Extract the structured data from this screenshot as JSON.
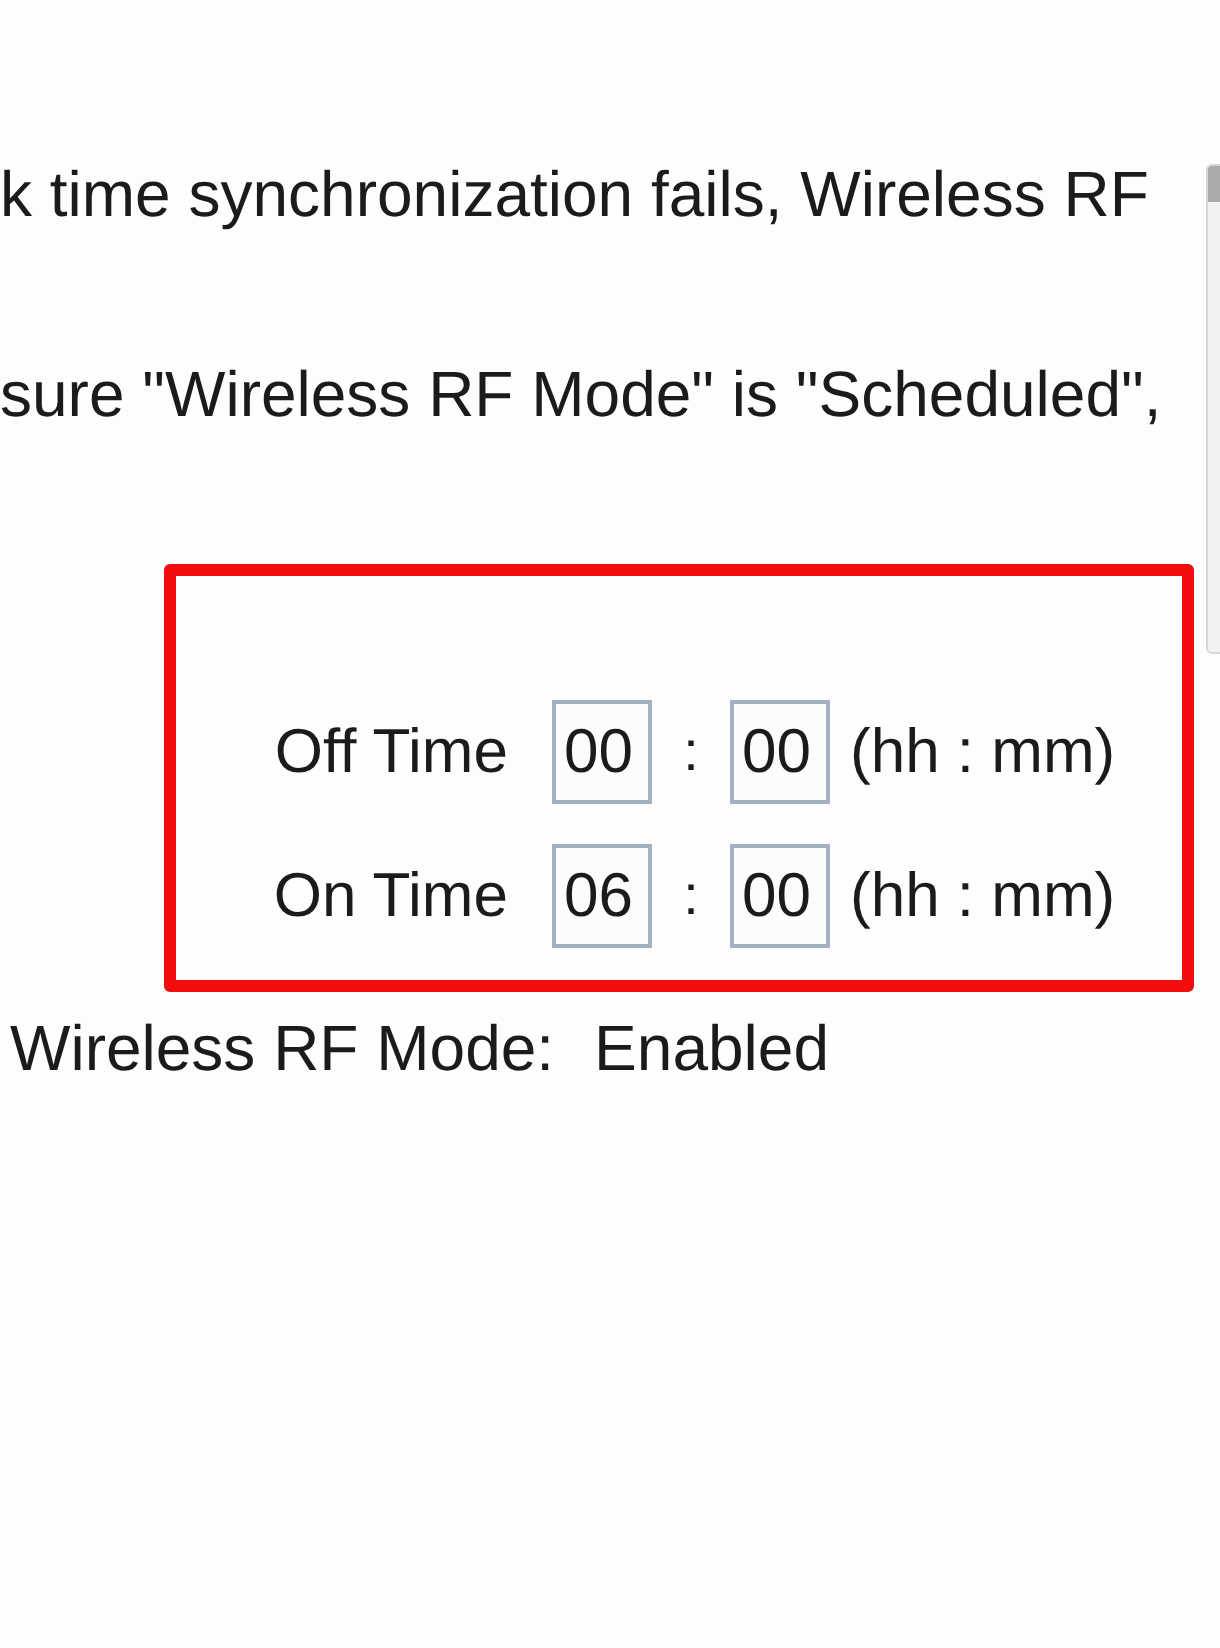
{
  "paragraphs": [
    {
      "text": "k time synchronization fails, Wireless RF"
    },
    {
      "text": "sure \"Wireless RF Mode\" is \"Scheduled\","
    }
  ],
  "schedule": {
    "highlighted": true,
    "rows": [
      {
        "label": "Off Time",
        "hours": "00",
        "separator": ":",
        "minutes": "00",
        "format": "(hh : mm)"
      },
      {
        "label": "On Time",
        "hours": "06",
        "separator": ":",
        "minutes": "00",
        "format": "(hh : mm)"
      }
    ]
  },
  "status": {
    "label": "Wireless RF Mode:",
    "value": "Enabled"
  }
}
